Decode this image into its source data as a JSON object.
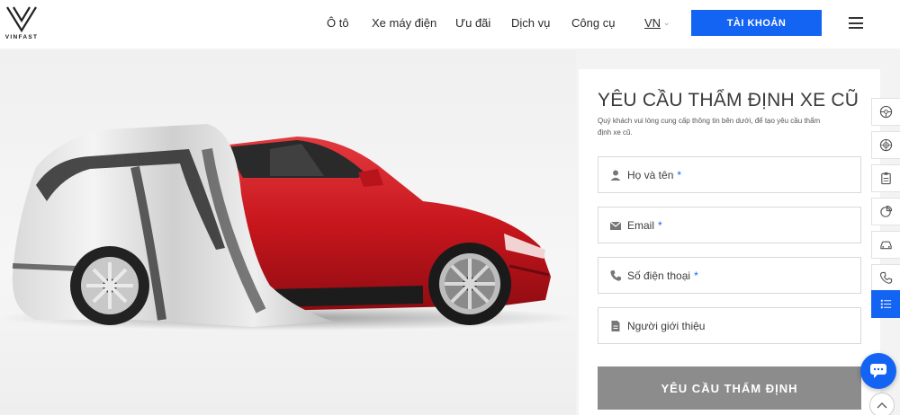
{
  "header": {
    "logo_text": "VINFAST",
    "nav": [
      {
        "label": "Ô tô"
      },
      {
        "label": "Xe máy điện"
      },
      {
        "label": "Ưu đãi"
      },
      {
        "label": "Dịch vụ"
      },
      {
        "label": "Công cụ"
      }
    ],
    "language": "VN",
    "account_button": "TÀI KHOẢN"
  },
  "form": {
    "title": "YÊU CẦU THẨM ĐỊNH XE CŨ",
    "subtitle": "Quý khách vui lòng cung cấp thông tin bên dưới, để tạo yêu cầu thẩm định xe cũ.",
    "fields": [
      {
        "label": "Họ và tên",
        "required": "*",
        "icon": "user-icon"
      },
      {
        "label": "Email",
        "required": "*",
        "icon": "mail-icon"
      },
      {
        "label": "Số điện thoại",
        "required": "*",
        "icon": "phone-icon"
      },
      {
        "label": "Người giới thiệu",
        "required": "",
        "icon": "document-icon"
      }
    ],
    "submit_label": "YÊU CẦU THẨM ĐỊNH"
  },
  "side_tools": [
    {
      "icon": "steering-wheel-icon"
    },
    {
      "icon": "wheel-icon"
    },
    {
      "icon": "clipboard-icon"
    },
    {
      "icon": "pie-chart-icon"
    },
    {
      "icon": "car-icon"
    },
    {
      "icon": "phone-icon"
    },
    {
      "icon": "list-icon",
      "active": true
    }
  ],
  "colors": {
    "brand_blue": "#1464f4",
    "submit_gray": "#8c8c8c",
    "car_red": "#d8232a"
  }
}
